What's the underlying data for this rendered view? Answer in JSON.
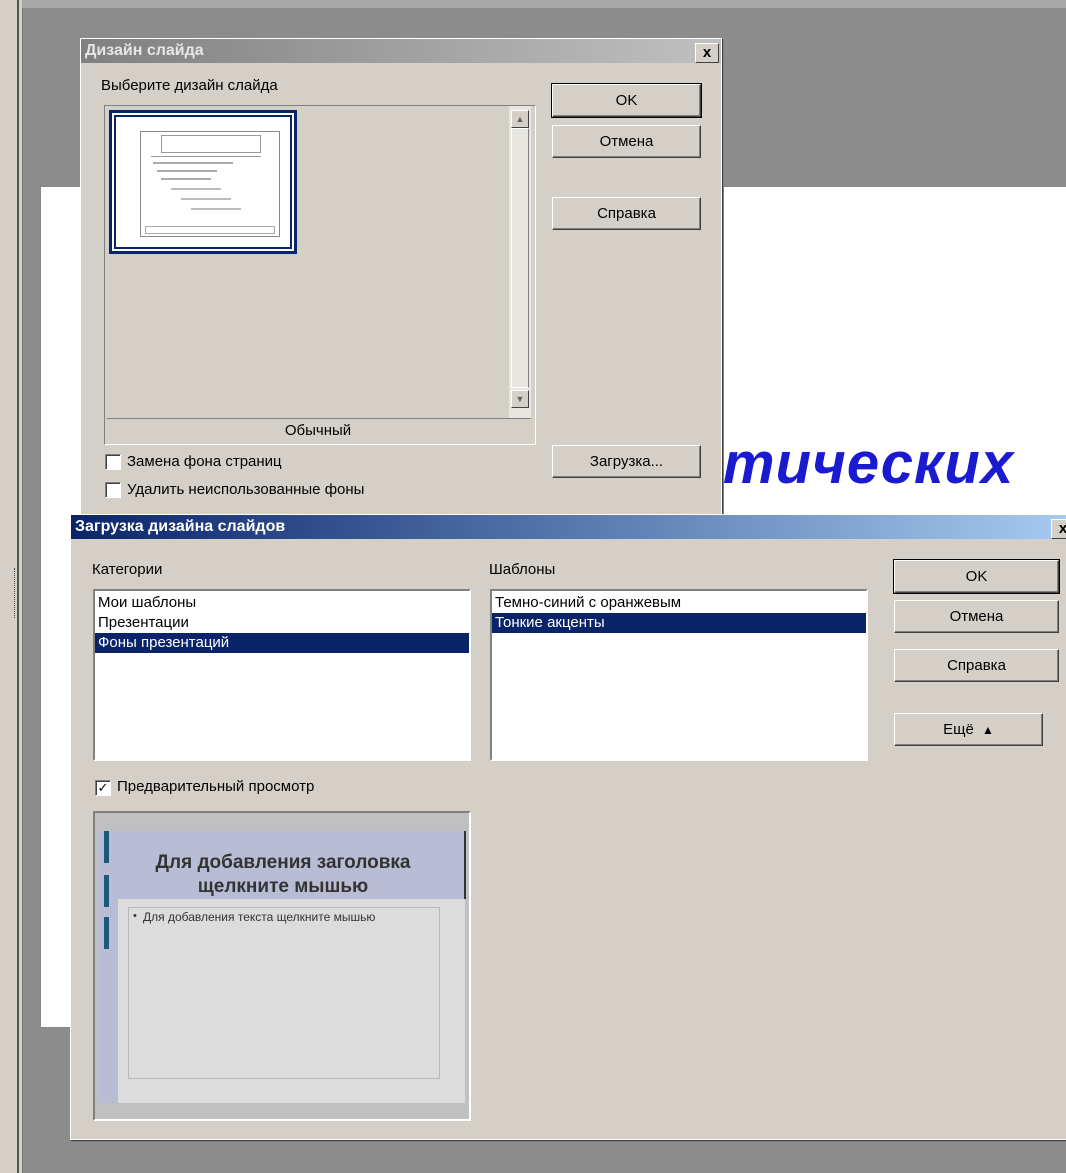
{
  "slide": {
    "visible_text": "тических"
  },
  "design_dialog": {
    "title": "Дизайн слайда",
    "close_label": "x",
    "choose_label": "Выберите дизайн слайда",
    "design_name": "Обычный",
    "ok_label": "OK",
    "cancel_label": "Отмена",
    "help_label": "Справка",
    "load_label": "Загрузка...",
    "replace_bg_label": "Замена фона страниц",
    "delete_unused_label": "Удалить неиспользованные фоны",
    "replace_bg_checked": false,
    "delete_unused_checked": false
  },
  "load_dialog": {
    "title": "Загрузка дизайна слайдов",
    "close_label": "x",
    "categories_label": "Категории",
    "categories": [
      {
        "label": "Мои шаблоны",
        "selected": false
      },
      {
        "label": "Презентации",
        "selected": false
      },
      {
        "label": "Фоны презентаций",
        "selected": true
      }
    ],
    "templates_label": "Шаблоны",
    "templates": [
      {
        "label": "Темно-синий с оранжевым",
        "selected": false
      },
      {
        "label": "Тонкие акценты",
        "selected": true
      }
    ],
    "ok_label": "OK",
    "cancel_label": "Отмена",
    "help_label": "Справка",
    "more_label": "Ещё",
    "preview_label": "Предварительный просмотр",
    "preview_checked": true,
    "preview": {
      "title": "Для добавления заголовка щелкните мышью",
      "body": "Для добавления текста щелкните мышью"
    }
  }
}
